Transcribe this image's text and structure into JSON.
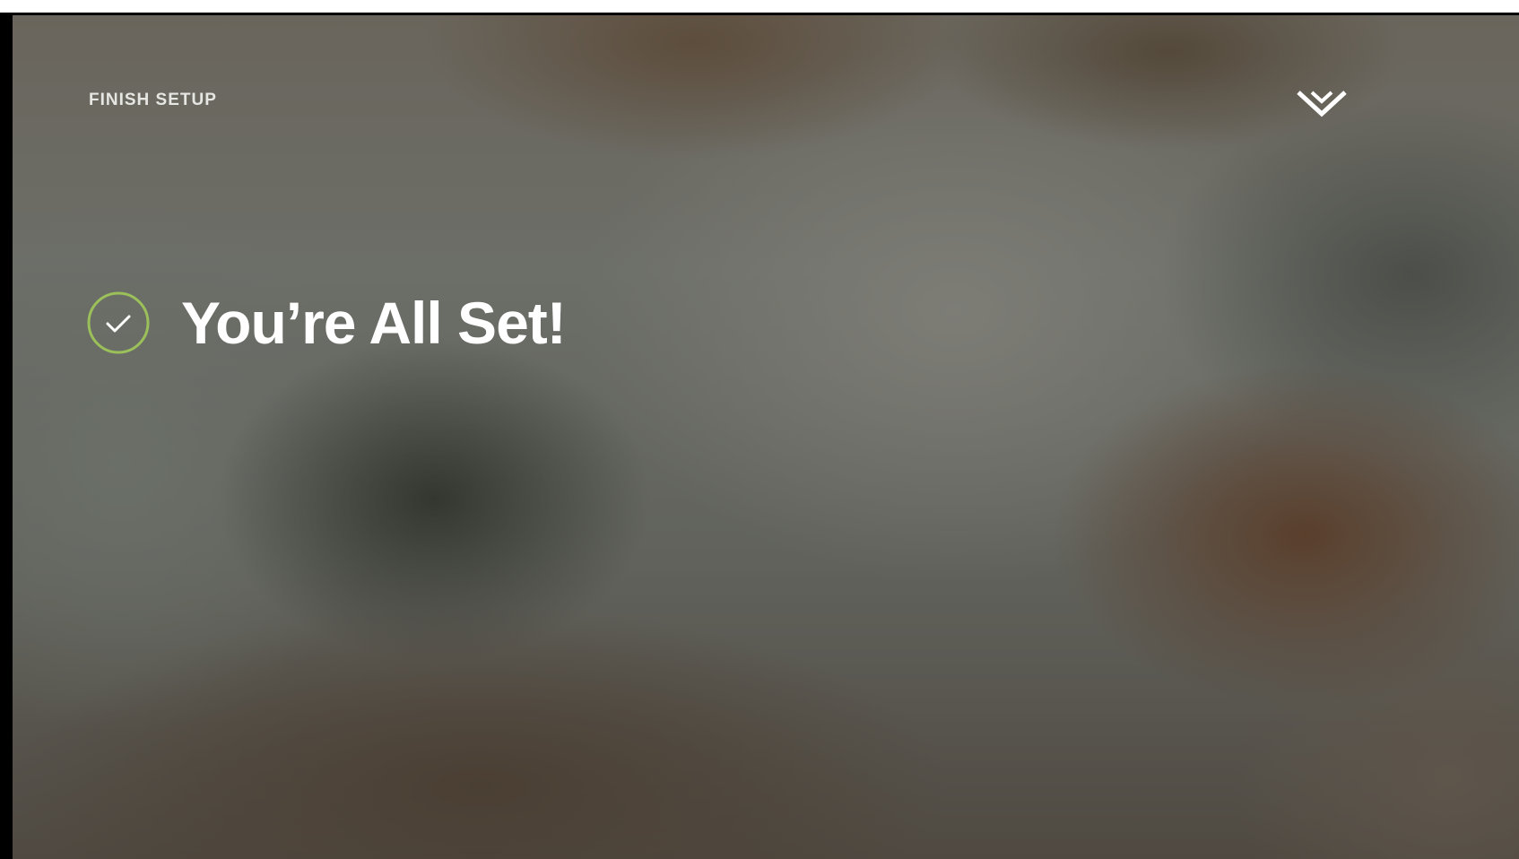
{
  "header": {
    "title": "FINISH SETUP",
    "logo_icon": "chevron-logo-icon"
  },
  "main": {
    "status_icon": "check-circle-icon",
    "heading": "You’re All Set!"
  },
  "colors": {
    "accent": "#9bbf5a",
    "text": "#ffffff"
  }
}
